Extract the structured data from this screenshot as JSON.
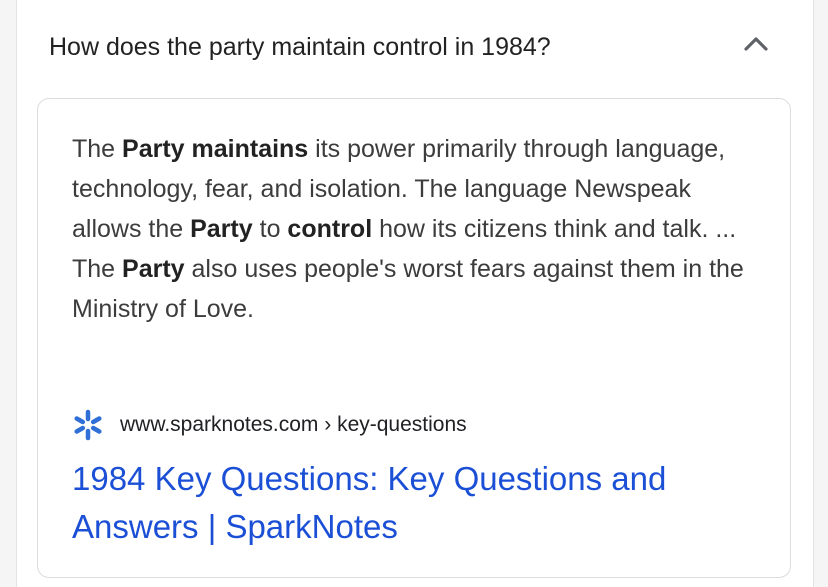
{
  "question": {
    "text": "How does the party maintain control in 1984?",
    "toggle_icon": "chevron-up-icon"
  },
  "answer": {
    "snippet_segments": [
      {
        "text": "The ",
        "bold": false
      },
      {
        "text": "Party maintains",
        "bold": true
      },
      {
        "text": " its power primarily through language, technology, fear, and isolation. The language Newspeak allows the ",
        "bold": false
      },
      {
        "text": "Party",
        "bold": true
      },
      {
        "text": " to ",
        "bold": false
      },
      {
        "text": "control",
        "bold": true
      },
      {
        "text": " how its citizens think and talk. ... The ",
        "bold": false
      },
      {
        "text": "Party",
        "bold": true
      },
      {
        "text": " also uses people's worst fears against them in the Ministry of Love.",
        "bold": false
      }
    ],
    "source": {
      "favicon": "sparknotes-asterisk-icon",
      "favicon_color": "#2f6fd6",
      "url_display": "www.sparknotes.com › key-questions"
    },
    "link": {
      "title": "1984 Key Questions: Key Questions and Answers | SparkNotes",
      "color": "#1a4fd6"
    }
  },
  "colors": {
    "background": "#f5f5f5",
    "text": "#3c3c3c",
    "bold_text": "#222222",
    "card_border": "#dadce0"
  }
}
